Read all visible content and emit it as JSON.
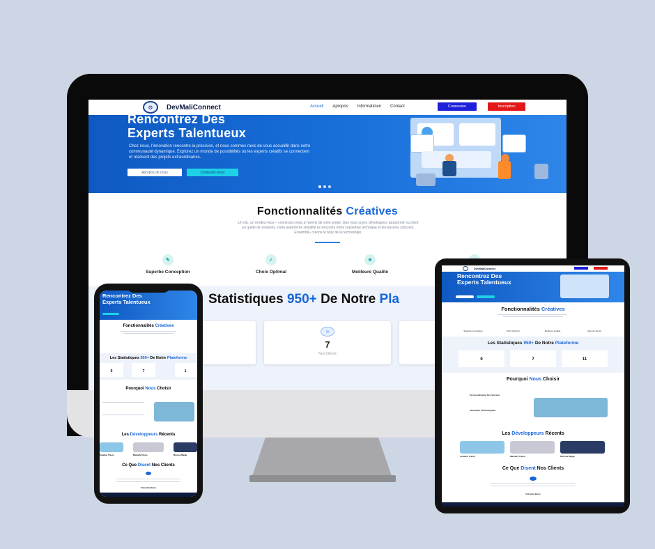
{
  "monitor": {
    "brand": "DevMaliConnect",
    "nav": [
      "Accueil",
      "Apropos",
      "Informaticien",
      "Contact"
    ],
    "connexion": "Connexion",
    "inscription": "Inscription",
    "hero_title_1": "Rencontrez Des",
    "hero_title_2": "Experts Talentueux",
    "hero_text": "Chez nous, l'innovation rencontre la précision, et nous sommes ravis de vous accueillir dans notre communauté dynamique. Explorez un monde de possibilités où les experts créatifs se connectent et réalisent des projets extraordinaires.",
    "hero_btn_1": "Apropos de nous",
    "hero_btn_2": "Contactez-nous",
    "feat_title_a": "Fonctionnalités",
    "feat_title_b": "Créatives",
    "feat_desc": "Un clic, un rendez-vous – connectez-vous à l'avenir de votre projet. Que vous soyez développeur passionné ou client en quête de solutions, notre plateforme simplifie la rencontre entre l'expertise technique et les besoins concrets. Ensemble, créons le futur de la technologie.",
    "features": [
      "Superbe Conception",
      "Choix Optimal",
      "Meilleure Qualité"
    ],
    "stats_title_a": "Statistiques",
    "stats_title_b": "950+",
    "stats_title_c": "De Notre",
    "stats_title_d": "Pla",
    "stat_value": "7",
    "stat_label": "Nos Clients"
  },
  "tablet": {
    "brand": "DevMaliConnect",
    "hero_title_1": "Rencontrez Des",
    "hero_title_2": "Experts Talentueux",
    "feat_title_a": "Fonctionnalités",
    "feat_title_b": "Créatives",
    "features": [
      "Superbe Conception",
      "Choix Optimal",
      "Meilleure Qualité",
      "Gain de Temps"
    ],
    "stats_a": "Les Statistiques",
    "stats_b": "950+",
    "stats_c": "De Notre",
    "stats_d": "Plateforme",
    "stats": [
      "0",
      "7",
      "11"
    ],
    "why_a": "Pourquoi",
    "why_b": "Nous",
    "why_c": "Choisir",
    "why_1": "Personnalisation Des Services",
    "why_2": "Innovation Technologique",
    "devs_a": "Les",
    "devs_b": "Développeurs",
    "devs_c": "Récents",
    "devs": [
      "Amadou Traore",
      "Mamady Traore",
      "Moussa Maiga"
    ],
    "clients_a": "Ce Que",
    "clients_b": "Disent",
    "clients_c": "Nos Clients",
    "testimonial_name": "Fatouma Barry"
  },
  "phone": {
    "hero_title_1": "Rencontrez Des",
    "hero_title_2": "Experts Talentueux",
    "feat_title_a": "Fonctionnalités",
    "feat_title_b": "Créatives",
    "stats_a": "Les Statistiques",
    "stats_b": "950+",
    "stats_c": "De Notre",
    "stats_d": "Plateforme",
    "stats": [
      "0",
      "7",
      "1"
    ],
    "why_a": "Pourquoi",
    "why_b": "Nous",
    "why_c": "Choisir",
    "devs_a": "Les",
    "devs_b": "Développeurs",
    "devs_c": "Récents",
    "devs": [
      "Amadou Traore",
      "Mamady Traore",
      "Moussa Maiga"
    ],
    "clients_a": "Ce Que",
    "clients_b": "Disent",
    "clients_c": "Nos Clients",
    "testimonial_name": "Fatouma Barry"
  }
}
